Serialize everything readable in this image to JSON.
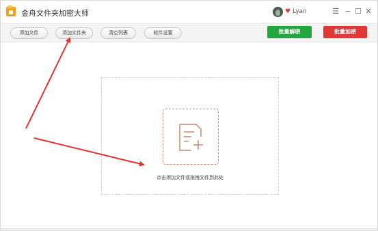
{
  "app": {
    "title": "金舟文件夹加密大师",
    "username": "Lyan",
    "vip_icon": "♥",
    "window_controls": {
      "menu": "☰",
      "minimize": "−",
      "maximize": "☐",
      "close": "✕"
    }
  },
  "toolbar": {
    "add_file": "添加文件",
    "add_folder": "添加文件夹",
    "clear_list": "清空列表",
    "settings": "软件设置",
    "batch_decrypt": "批量解密",
    "batch_encrypt": "批量加密"
  },
  "drop_area": {
    "hint": "点击添加文件或拖拽文件到此处",
    "icon": "add-document-icon"
  },
  "annotations": {
    "arrow_color": "#e0322b",
    "count": 2
  },
  "colors": {
    "decrypt": "#22a73f",
    "encrypt": "#e13837",
    "drop_icon": "#c9866a"
  }
}
